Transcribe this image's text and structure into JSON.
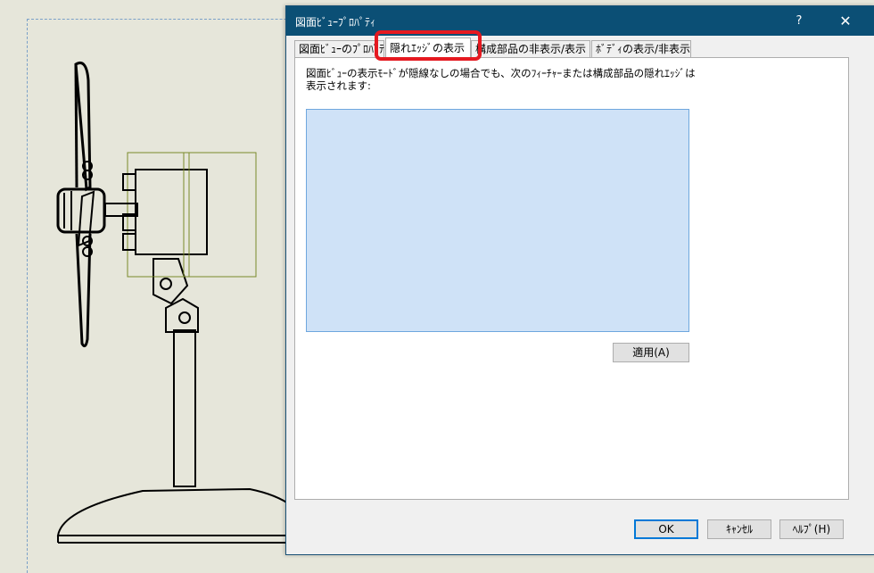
{
  "dialog": {
    "title": "図面ﾋﾞｭｰﾌﾟﾛﾊﾟﾃｨ",
    "help_button": "?",
    "close_button": "✕"
  },
  "tabs": [
    {
      "label": "図面ﾋﾞｭｰのﾌﾟﾛﾊﾟﾃｨ",
      "active": false
    },
    {
      "label": "隠れｴｯｼﾞの表示",
      "active": true
    },
    {
      "label": "構成部品の非表示/表示",
      "active": false
    },
    {
      "label": "ﾎﾞﾃﾞｨの表示/非表示",
      "active": false
    }
  ],
  "panel": {
    "description": "図面ﾋﾞｭｰの表示ﾓｰﾄﾞが隠線なしの場合でも、次のﾌｨｰﾁｬｰまたは構成部品の隠れｴｯｼﾞは表示されます:",
    "apply_button": "適用(A)"
  },
  "footer": {
    "ok_button": "OK",
    "cancel_button": "ｷｬﾝｾﾙ",
    "help_button": "ﾍﾙﾌﾟ(H)"
  },
  "colors": {
    "titlebar": "#0b4f75",
    "list_selection": "#cfe2f7",
    "highlight": "#e51920",
    "cad_background": "#e6e6da"
  }
}
